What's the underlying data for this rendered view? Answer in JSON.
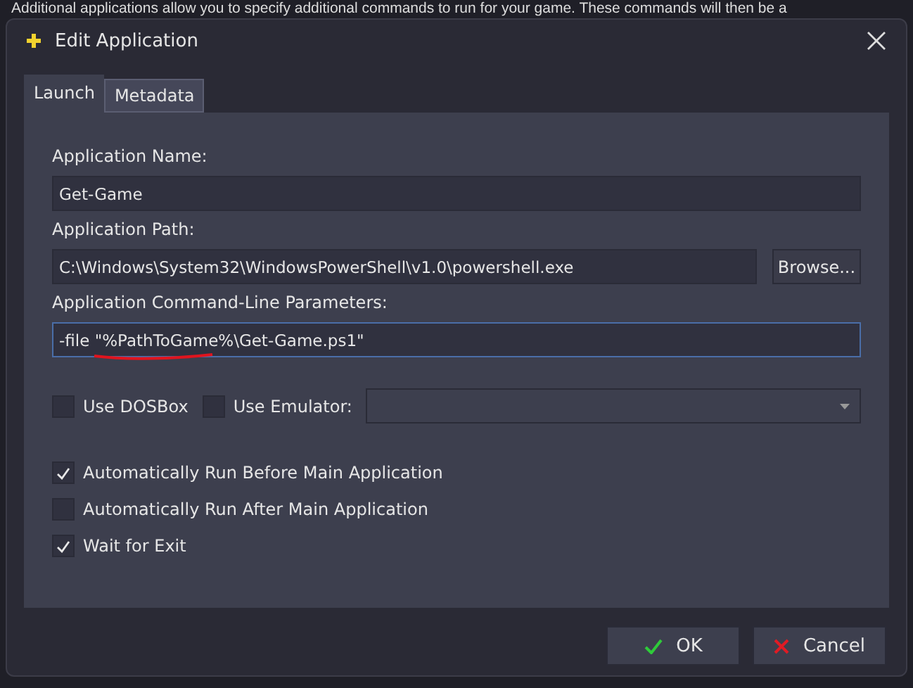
{
  "background_text": "Additional applications allow you to specify additional commands to run for your game.  These commands will then be a",
  "window": {
    "title": "Edit Application"
  },
  "tabs": [
    {
      "label": "Launch",
      "selected": true
    },
    {
      "label": "Metadata",
      "selected": false
    }
  ],
  "fields": [
    {
      "label": "Application Name:",
      "value": "Get-Game",
      "focused": false
    },
    {
      "label": "Application Path:",
      "value": "C:\\Windows\\System32\\WindowsPowerShell\\v1.0\\powershell.exe",
      "button": "Browse...",
      "focused": false
    },
    {
      "label": "Application Command-Line Parameters:",
      "value": "-file \"%PathToGame%\\Get-Game.ps1\"",
      "focused": true
    }
  ],
  "emulator_row": {
    "dosbox": {
      "label": "Use DOSBox",
      "checked": false
    },
    "emulator": {
      "label": "Use Emulator:",
      "checked": false
    }
  },
  "options": [
    {
      "label": "Automatically Run Before Main Application",
      "checked": true
    },
    {
      "label": "Automatically Run After Main Application",
      "checked": false
    },
    {
      "label": "Wait for Exit",
      "checked": true
    }
  ],
  "buttons": [
    {
      "label": "OK",
      "kind": "ok"
    },
    {
      "label": "Cancel",
      "kind": "cancel"
    }
  ]
}
